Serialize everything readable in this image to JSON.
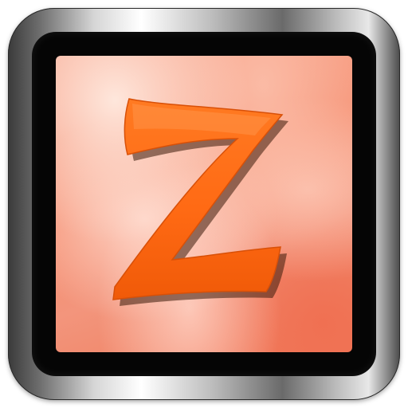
{
  "icon": {
    "letter": "Z",
    "letter_color": "#ff6a14",
    "panel_color": "#f58d6f",
    "frame_color": "#050505"
  }
}
